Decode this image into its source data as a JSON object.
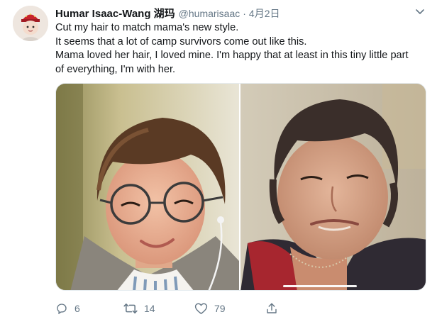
{
  "tweet": {
    "display_name": "Humar Isaac-Wang 湖玛",
    "handle": "@humarisaac",
    "separator": "·",
    "date": "4月2日",
    "lines": [
      "Cut my hair to match mama's new style.",
      "It seems that a lot of camp survivors come out like this.",
      "Mama loved her hair, I loved mine. I'm happy that at least in this tiny little part",
      "of everything, I'm with her."
    ],
    "media": {
      "left_photo_icon": "photo-person-short-hair-glasses",
      "right_photo_icon": "photo-older-woman-short-hair"
    },
    "actions": {
      "reply": {
        "icon": "reply-icon",
        "count": "6"
      },
      "retweet": {
        "icon": "retweet-icon",
        "count": "14"
      },
      "like": {
        "icon": "heart-icon",
        "count": "79"
      },
      "share": {
        "icon": "share-icon"
      }
    }
  },
  "colors": {
    "text": "#14171a",
    "muted": "#657786",
    "divider": "#e6ecf0"
  }
}
